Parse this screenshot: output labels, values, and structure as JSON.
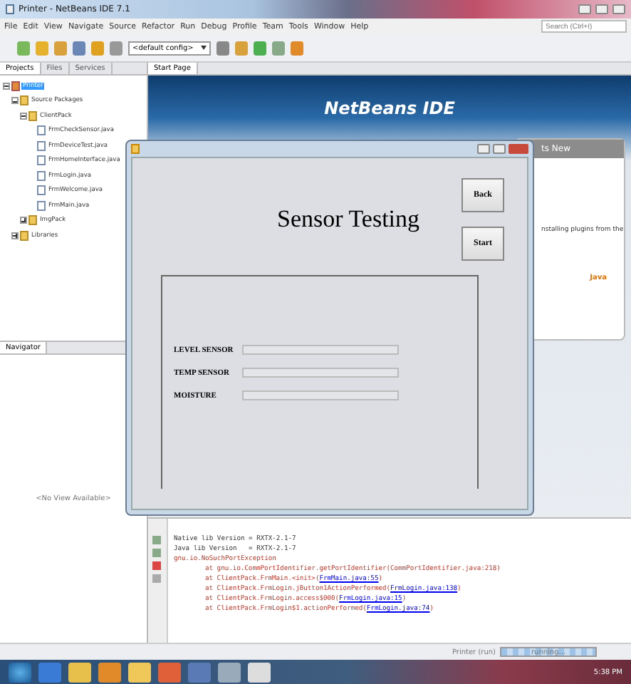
{
  "window": {
    "title": "Printer - NetBeans IDE 7.1"
  },
  "menu": [
    "File",
    "Edit",
    "View",
    "Navigate",
    "Source",
    "Refactor",
    "Run",
    "Debug",
    "Profile",
    "Team",
    "Tools",
    "Window",
    "Help"
  ],
  "search": {
    "placeholder": "Search (Ctrl+I)"
  },
  "toolbar": {
    "config": "<default config>"
  },
  "project_tabs": [
    {
      "label": "Projects",
      "selected": true
    },
    {
      "label": "Files",
      "selected": false
    },
    {
      "label": "Services",
      "selected": false
    }
  ],
  "tree": [
    {
      "label": "Printer",
      "kind": "project",
      "expanded": true,
      "selected": true,
      "children": [
        {
          "label": "Source Packages",
          "kind": "folder",
          "expanded": true,
          "selected": false,
          "children": [
            {
              "label": "ClientPack",
              "kind": "package",
              "expanded": true,
              "selected": false,
              "children": [
                {
                  "label": "FrmCheckSensor.java",
                  "kind": "file",
                  "selected": false
                },
                {
                  "label": "FrmDeviceTest.java",
                  "kind": "file",
                  "selected": false
                },
                {
                  "label": "FrmHomeInterface.java",
                  "kind": "file",
                  "selected": false
                },
                {
                  "label": "FrmLogin.java",
                  "kind": "file",
                  "selected": false
                },
                {
                  "label": "FrmWelcome.java",
                  "kind": "file",
                  "selected": false
                },
                {
                  "label": "FrmMain.java",
                  "kind": "file",
                  "selected": false
                }
              ]
            },
            {
              "label": "ImgPack",
              "kind": "package",
              "expanded": false,
              "selected": false
            }
          ]
        },
        {
          "label": "Libraries",
          "kind": "folder",
          "expanded": false,
          "selected": false
        }
      ]
    }
  ],
  "navigator": {
    "tab": "Navigator",
    "empty": "<No View Available>"
  },
  "editor_tabs": [
    {
      "label": "Start Page",
      "selected": true
    }
  ],
  "start_page": {
    "logo": "NetBeans",
    "logo_suffix": "IDE",
    "card_title": "ts New",
    "card_text": "nstalling plugins from the",
    "java": "Java"
  },
  "output": [
    {
      "kind": "info",
      "text": "Native lib Version = RXTX-2.1-7"
    },
    {
      "kind": "info",
      "text": "Java lib Version   = RXTX-2.1-7"
    },
    {
      "kind": "error",
      "text": "gnu.io.NoSuchPortException"
    },
    {
      "kind": "trace",
      "text": "at gnu.io.CommPortIdentifier.getPortIdentifier(CommPortIdentifier.java:218)"
    },
    {
      "kind": "trace",
      "text": "at ClientPack.FrmMain.<init>(",
      "link": "FrmMain.java:55",
      "after": ")"
    },
    {
      "kind": "trace",
      "text": "at ClientPack.FrmLogin.jButton1ActionPerformed(",
      "link": "FrmLogin.java:138",
      "after": ")"
    },
    {
      "kind": "trace",
      "text": "at ClientPack.FrmLogin.access$000(",
      "link": "FrmLogin.java:15",
      "after": ")"
    },
    {
      "kind": "trace",
      "text": "at ClientPack.FrmLogin$1.actionPerformed(",
      "link": "FrmLogin.java:74",
      "after": ")"
    }
  ],
  "status_bar": {
    "task": "Printer (run)",
    "progress_text": "running...",
    "level": 1
  },
  "taskbar": {
    "time": "5:38 PM"
  },
  "dialog": {
    "heading": "Sensor Testing",
    "buttons": [
      "Back",
      "Start"
    ],
    "sensors": [
      {
        "name": "LEVEL SENSOR",
        "level": 0
      },
      {
        "name": "TEMP SENSOR",
        "level": 0
      },
      {
        "name": "MOISTURE",
        "level": 0
      }
    ]
  }
}
